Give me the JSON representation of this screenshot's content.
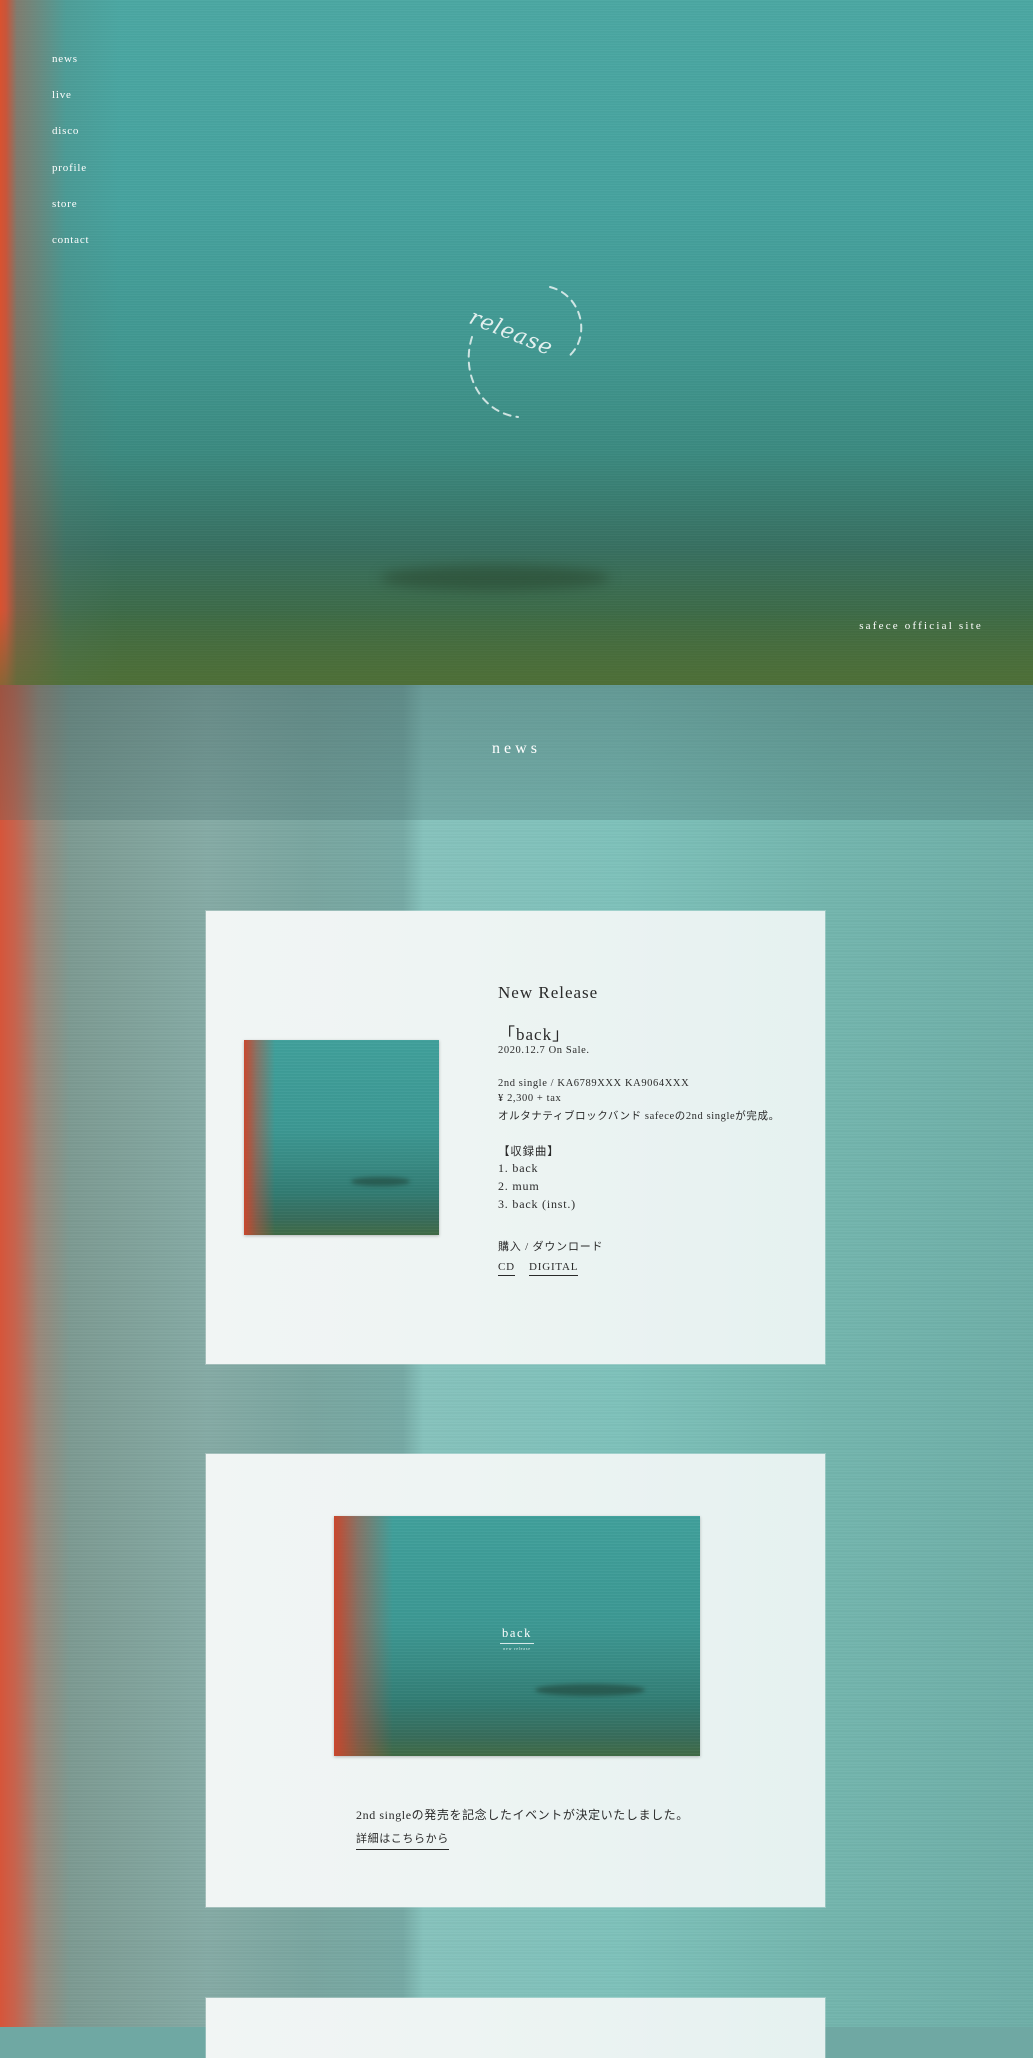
{
  "nav": {
    "items": [
      "news",
      "live",
      "disco",
      "profile",
      "store",
      "contact"
    ]
  },
  "hero": {
    "mark_text": "release",
    "caption": "safece official site"
  },
  "news": {
    "title": "news",
    "release_card": {
      "heading": "New Release",
      "title": "「back」",
      "date": "2020.12.7  On Sale.",
      "spec": "2nd single / KA6789XXX KA9064XXX",
      "price": "¥ 2,300 + tax",
      "description": "オルタナティブロックバンド safeceの2nd singleが完成。",
      "tracks_heading": "【収録曲】",
      "tracks": [
        "1. back",
        "2. mum",
        "3. back (inst.)"
      ],
      "buy_heading": "購入 / ダウンロード",
      "buy_links": [
        "CD",
        "DIGITAL"
      ]
    },
    "event_card": {
      "image_title": "back",
      "image_subtitle": "new release",
      "text": "2nd singleの発売を記念したイベントが決定いたしました。",
      "link": "詳細はこちらから"
    }
  },
  "colors": {
    "teal": "#4aa8a3",
    "red_edge": "#d9522f",
    "card": "#eef4f3",
    "text": "#2a2a2a"
  }
}
